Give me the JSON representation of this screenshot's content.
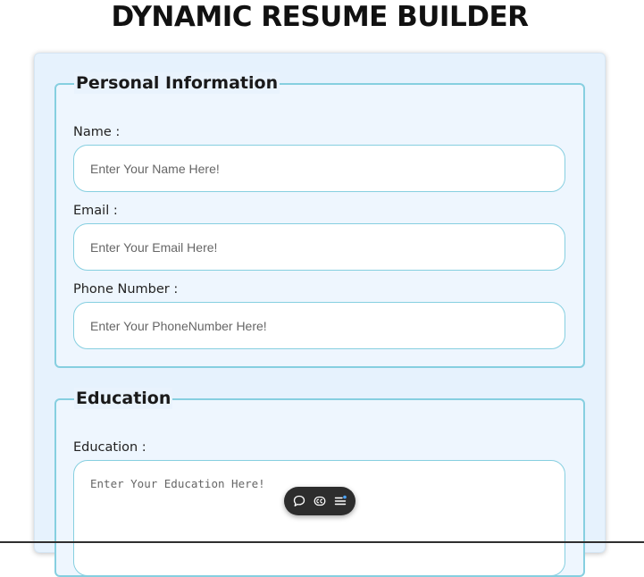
{
  "page": {
    "title": "DYNAMIC RESUME BUILDER"
  },
  "personal_info": {
    "legend": "Personal Information",
    "name": {
      "label": "Name :",
      "value": "",
      "placeholder": "Enter Your Name Here!"
    },
    "email": {
      "label": "Email :",
      "value": "",
      "placeholder": "Enter Your Email Here!"
    },
    "phone": {
      "label": "Phone Number :",
      "value": "",
      "placeholder": "Enter Your PhoneNumber Here!"
    }
  },
  "education": {
    "legend": "Education",
    "field": {
      "label": "Education :",
      "value": "",
      "placeholder": "Enter Your Education Here!"
    }
  },
  "floating_toolbar": {
    "icons": [
      "chat-bubble-icon",
      "caption-toggle-icon",
      "menu-list-icon"
    ]
  },
  "colors": {
    "accent_border": "#86cfe0",
    "card_background": "#e6f2fd",
    "toolbar_background": "#2d2d2d"
  }
}
